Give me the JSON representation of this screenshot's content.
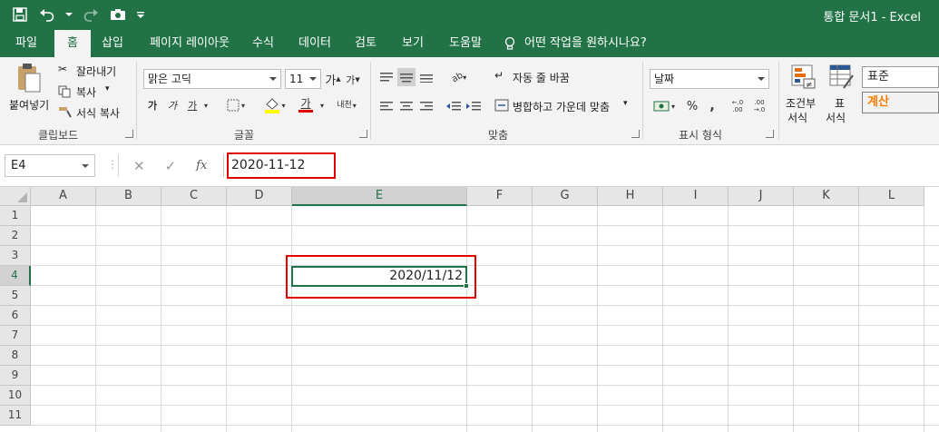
{
  "window": {
    "title": "통합 문서1  -  Excel"
  },
  "qat": {
    "icons": [
      "save-icon",
      "undo-icon",
      "redo-icon",
      "camera-icon",
      "customize-icon"
    ]
  },
  "tabs": [
    {
      "label": "파일"
    },
    {
      "label": "홈"
    },
    {
      "label": "삽입"
    },
    {
      "label": "페이지 레이아웃"
    },
    {
      "label": "수식"
    },
    {
      "label": "데이터"
    },
    {
      "label": "검토"
    },
    {
      "label": "보기"
    },
    {
      "label": "도움말"
    }
  ],
  "tell_me": "어떤 작업을 원하시나요?",
  "clipboard": {
    "paste": "붙여넣기",
    "cut": "잘라내기",
    "copy": "복사",
    "format_painter": "서식 복사",
    "group": "클립보드"
  },
  "font": {
    "name": "맑은 고딕",
    "size": "11",
    "bold": "가",
    "italic": "가",
    "underline": "가",
    "color_glyph": "가",
    "phonetic": "내천",
    "group": "글꼴"
  },
  "alignment": {
    "wrap": "자동 줄 바꿈",
    "merge": "병합하고 가운데 맞춤",
    "group": "맞춤"
  },
  "number": {
    "format": "날짜",
    "percent": "%",
    "comma": ",",
    "group": "표시 형식"
  },
  "styles": {
    "conditional": "조건부",
    "conditional2": "서식",
    "table": "표",
    "table2": "서식",
    "normal": "표준",
    "calc": "계산"
  },
  "colors": {
    "brand": "#217346",
    "highlight": "#e00000",
    "calc_text": "#fa7d00"
  },
  "formula_bar": {
    "name_box": "E4",
    "cancel": "✕",
    "enter": "✓",
    "fx": "fx",
    "value": "2020-11-12"
  },
  "sheet": {
    "columns": [
      "A",
      "B",
      "C",
      "D",
      "E",
      "F",
      "G",
      "H",
      "I",
      "J",
      "K",
      "L"
    ],
    "rows": [
      "1",
      "2",
      "3",
      "4",
      "5",
      "6",
      "7",
      "8",
      "9",
      "10",
      "11"
    ],
    "selected_cell": "E4",
    "cell_value": "2020/11/12"
  }
}
